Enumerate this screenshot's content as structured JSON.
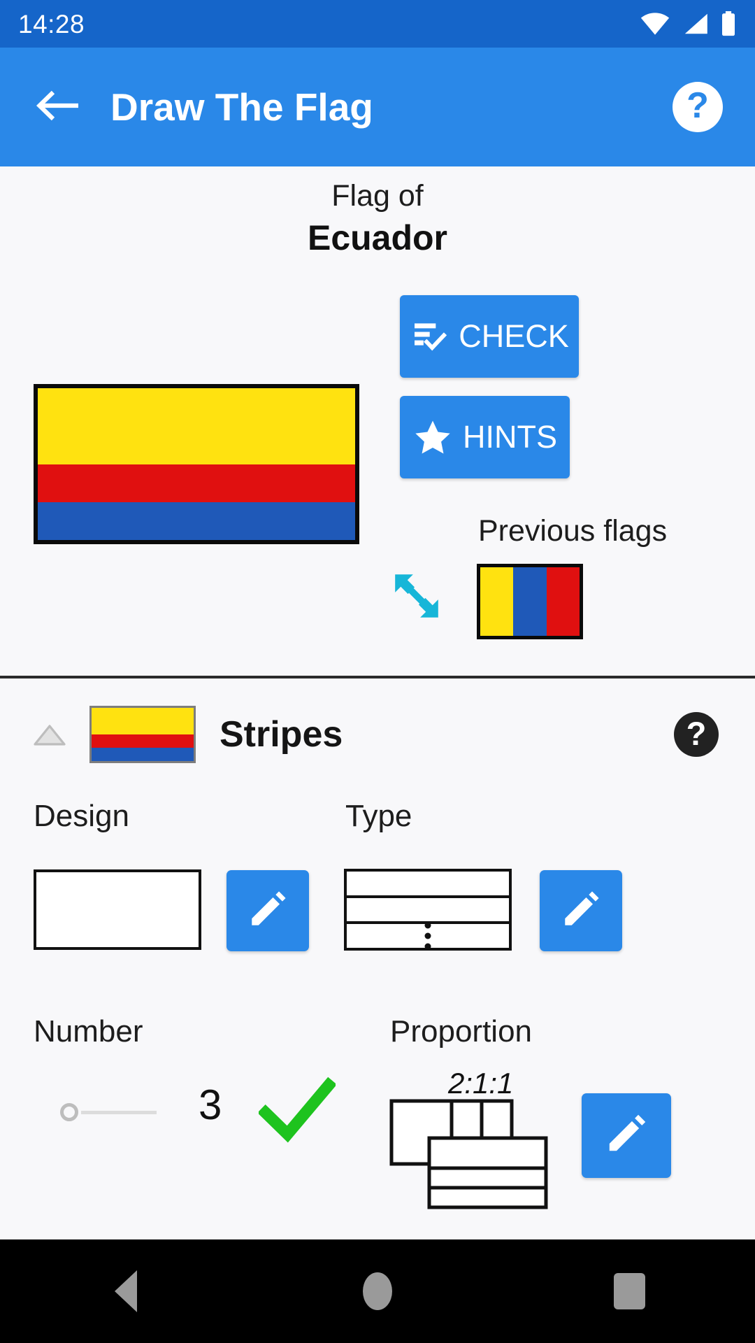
{
  "status_bar": {
    "time": "14:28",
    "icons": [
      "wifi-icon",
      "cellular-signal-icon",
      "battery-icon"
    ]
  },
  "app_bar": {
    "back_icon": "arrow-left-icon",
    "title": "Draw The Flag",
    "help_icon": "help-circle-icon",
    "help_glyph": "?"
  },
  "flag_panel": {
    "caption_prefix": "Flag of",
    "country": "Ecuador",
    "target_flag": {
      "orientation": "horizontal",
      "border_color": "#0a0a0a",
      "bands": [
        {
          "color": "#ffe210",
          "name": "yellow",
          "weight": 2
        },
        {
          "color": "#e01010",
          "name": "red",
          "weight": 1
        },
        {
          "color": "#1f59b8",
          "name": "blue",
          "weight": 1
        }
      ]
    },
    "check_button": {
      "label": "CHECK",
      "icon": "fact-check-icon"
    },
    "hints_button": {
      "label": "HINTS",
      "icon": "star-icon"
    },
    "previous_label": "Previous flags",
    "resize_icon": "resize-diagonal-icon",
    "resize_color": "#17b6d8",
    "previous_flag": {
      "orientation": "vertical",
      "border_color": "#0a0a0a",
      "bands": [
        {
          "color": "#ffe210",
          "name": "yellow"
        },
        {
          "color": "#1f59b8",
          "name": "blue"
        },
        {
          "color": "#e01010",
          "name": "red"
        }
      ]
    }
  },
  "stripes_section": {
    "collapse_icon": "chevron-up-triangle-icon",
    "title": "Stripes",
    "help_icon": "help-circle-icon",
    "help_glyph": "?",
    "thumbnail_bands": [
      {
        "color": "#ffe210",
        "weight": 2
      },
      {
        "color": "#e01010",
        "weight": 1
      },
      {
        "color": "#1f59b8",
        "weight": 1
      }
    ],
    "design": {
      "label": "Design",
      "preview_icon": "blank-rectangle-icon",
      "edit_icon": "pencil-icon"
    },
    "type": {
      "label": "Type",
      "preview_icon": "horizontal-stripes-icon",
      "edit_icon": "pencil-icon"
    },
    "number": {
      "label": "Number",
      "value": "3",
      "slider_position_percent": 0,
      "status_icon": "green-check-icon",
      "status_color": "#1ec31e"
    },
    "proportion": {
      "label": "Proportion",
      "ratio": "2:1:1",
      "diagram_icon": "proportion-diagram-icon",
      "edit_icon": "pencil-icon"
    }
  },
  "nav_bar": {
    "back_icon": "nav-back-triangle-icon",
    "home_icon": "nav-home-circle-icon",
    "recents_icon": "nav-recents-square-icon"
  },
  "colors": {
    "status_bar": "#1565c9",
    "app_bar": "#2a88e8",
    "accent": "#2a88e8",
    "page_bg": "#f8f8fa",
    "divider": "#2b2b2b"
  }
}
